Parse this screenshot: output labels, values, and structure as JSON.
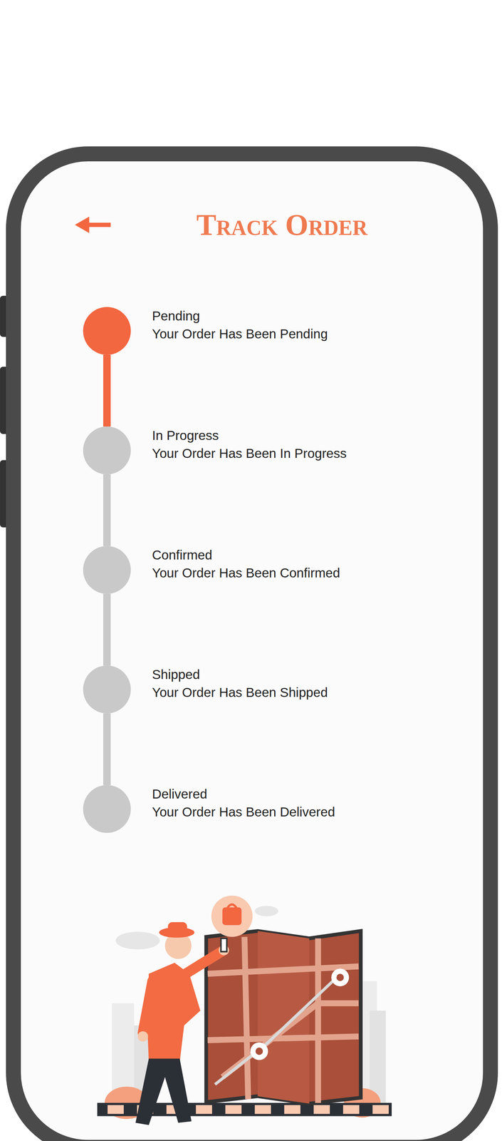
{
  "header": {
    "title": "Track Order"
  },
  "steps": [
    {
      "title": "Pending",
      "subtitle": "Your Order Has Been Pending",
      "active": true
    },
    {
      "title": "In Progress",
      "subtitle": "Your Order Has Been In Progress",
      "active": false
    },
    {
      "title": "Confirmed",
      "subtitle": "Your Order Has Been Confirmed",
      "active": false
    },
    {
      "title": "Shipped",
      "subtitle": "Your Order Has Been Shipped",
      "active": false
    },
    {
      "title": "Delivered",
      "subtitle": "Your Order Has Been Delivered",
      "active": false
    }
  ]
}
